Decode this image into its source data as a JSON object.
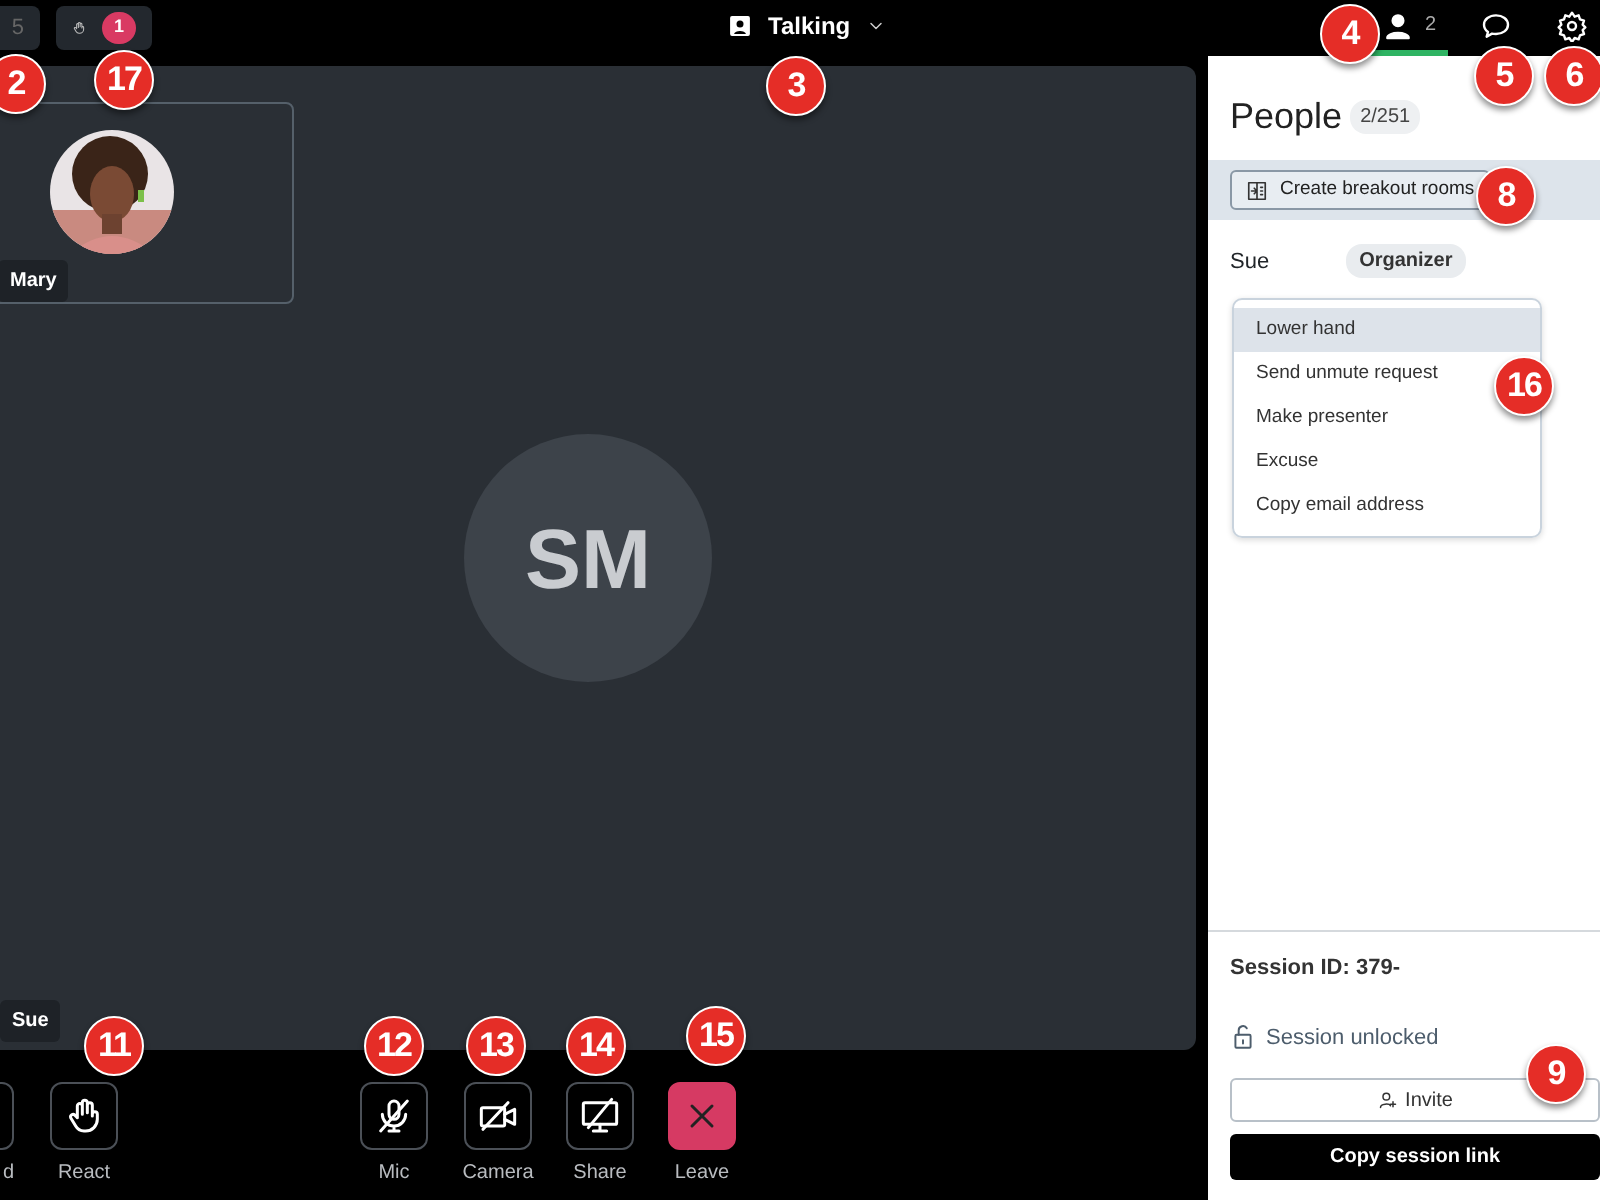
{
  "top_bar": {
    "buttons": [
      {
        "kind": "count",
        "label": "5"
      },
      {
        "kind": "hands",
        "count": "1"
      }
    ],
    "view_menu": {
      "label": "Talking"
    }
  },
  "tabs": [
    {
      "kind": "people",
      "count": "2",
      "selected": true
    },
    {
      "kind": "chat",
      "selected": false
    },
    {
      "kind": "settings",
      "selected": false
    }
  ],
  "stage": {
    "initials": "SM",
    "thumbnail": {
      "name": "Mary",
      "kind": "picture"
    },
    "self_label": "Sue"
  },
  "controls": [
    {
      "kind": "hand",
      "label": "d"
    },
    {
      "kind": "react",
      "label": "React"
    },
    {
      "kind": "mic",
      "label": "Mic"
    },
    {
      "kind": "camera",
      "label": "Camera"
    },
    {
      "kind": "share",
      "label": "Share"
    },
    {
      "kind": "leave",
      "label": "Leave"
    }
  ],
  "people": {
    "title": "People",
    "count": "2/251",
    "breakout_button": "Create breakout rooms",
    "participants": [
      {
        "name": "Sue",
        "role": "Organizer"
      }
    ],
    "menu": [
      {
        "label": "Lower hand",
        "selected": true
      },
      {
        "label": "Send unmute request",
        "selected": false
      },
      {
        "label": "Make presenter",
        "selected": false
      },
      {
        "label": "Excuse",
        "selected": false
      },
      {
        "label": "Copy email address",
        "selected": false
      }
    ]
  },
  "session": {
    "id": "Session ID: 379-",
    "lock_status": "Session unlocked",
    "invite_button": "Invite",
    "copy_button": "Copy session link"
  },
  "callouts": [
    {
      "number": "2"
    },
    {
      "number": "17"
    },
    {
      "number": "3"
    },
    {
      "number": "4"
    },
    {
      "number": "5"
    },
    {
      "number": "6"
    },
    {
      "number": "8"
    },
    {
      "number": "16"
    },
    {
      "number": "9"
    },
    {
      "number": "11"
    },
    {
      "number": "12"
    },
    {
      "number": "13"
    },
    {
      "number": "14"
    },
    {
      "number": "15"
    }
  ]
}
